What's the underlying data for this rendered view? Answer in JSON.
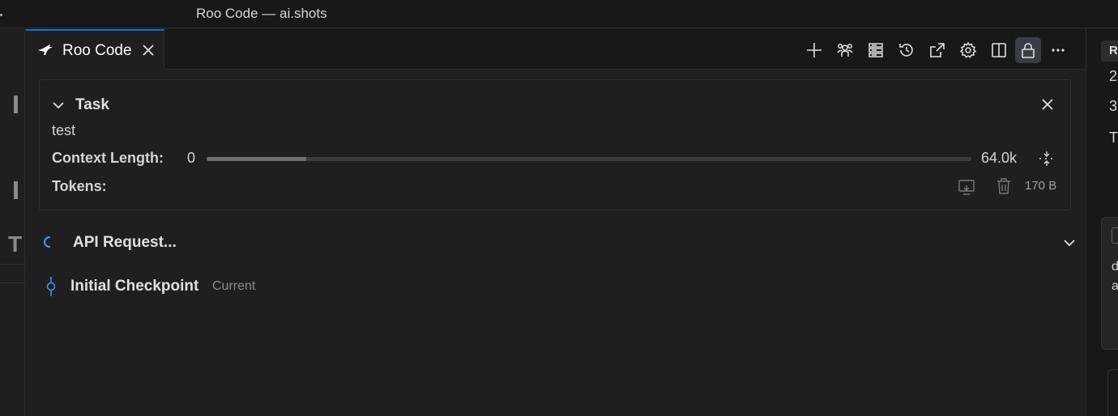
{
  "window": {
    "title": "Roo Code — ai.shots"
  },
  "tab": {
    "label": "Roo Code"
  },
  "toolbar": {
    "actions": [
      {
        "name": "new-task",
        "icon": "plus-icon"
      },
      {
        "name": "modes",
        "icon": "people-icon"
      },
      {
        "name": "servers",
        "icon": "server-icon"
      },
      {
        "name": "history",
        "icon": "history-icon"
      },
      {
        "name": "popout",
        "icon": "open-external-icon"
      },
      {
        "name": "settings",
        "icon": "gear-icon"
      },
      {
        "name": "split",
        "icon": "split-editor-icon"
      },
      {
        "name": "lock",
        "icon": "lock-icon",
        "active": true
      },
      {
        "name": "more",
        "icon": "ellipsis-icon"
      }
    ]
  },
  "task": {
    "title": "Task",
    "text": "test",
    "context_label": "Context Length:",
    "context_used": "0",
    "context_max": "64.0k",
    "context_fraction": 0.13,
    "tokens_label": "Tokens:",
    "size": "170 B"
  },
  "api": {
    "label": "API Request..."
  },
  "checkpoint": {
    "label": "Initial Checkpoint",
    "status": "Current"
  },
  "right_panel": {
    "chip": "R",
    "lines": [
      "2",
      "3",
      "T"
    ],
    "panel_lines": [
      "d",
      "a"
    ]
  },
  "left_panel": {
    "glyph": "T"
  },
  "colors": {
    "accent": "#0078d4",
    "checkpoint": "#3794ff"
  }
}
